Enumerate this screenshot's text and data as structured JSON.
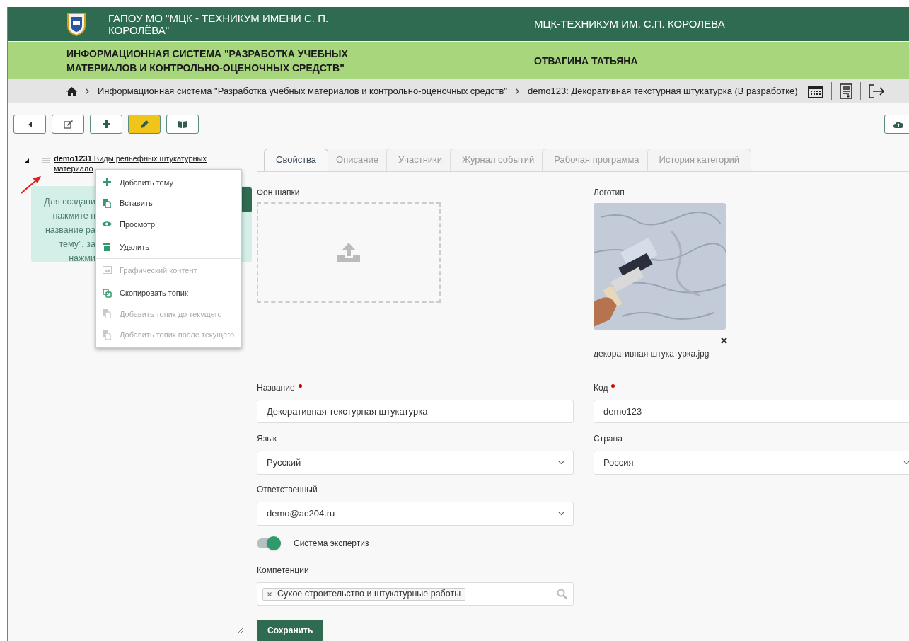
{
  "header": {
    "org_name": "ГАПОУ МО \"МЦК - ТЕХНИКУМ ИМЕНИ С. П. КОРОЛЁВА\"",
    "org_short": "МЦК-ТЕХНИКУМ ИМ. С.П. КОРОЛЕВА",
    "system_title": "ИНФОРМАЦИОННАЯ СИСТЕМА \"РАЗРАБОТКА УЧЕБНЫХ МАТЕРИАЛОВ И КОНТРОЛЬНО-ОЦЕНОЧНЫХ СРЕДСТВ\"",
    "user_name": "ОТВАГИНА ТАТЬЯНА"
  },
  "breadcrumbs": [
    "Информационная система \"Разработка учебных материалов и контрольно-оценочных средств\"",
    "demo123: Декоративная текстурная штукатурка (В разработке)"
  ],
  "toolbar": [
    {
      "active": false
    },
    {
      "active": false
    },
    {
      "active": false
    },
    {
      "active": true
    },
    {
      "active": false
    }
  ],
  "tree": {
    "expanded": true,
    "label": "**demo1231** Виды рельефных штукатурных материало"
  },
  "hint_lines": [
    "Для создани",
    "нажмите п",
    "название ра",
    "тему\", за",
    "нажми"
  ],
  "context_menu": [
    [
      {
        "label": "Добавить тему",
        "disabled": false
      },
      {
        "label": "Вставить",
        "disabled": false
      },
      {
        "label": "Просмотр",
        "disabled": false
      }
    ],
    [
      {
        "label": "Удалить",
        "disabled": false
      }
    ],
    [
      {
        "label": "Графический контент",
        "disabled": true
      }
    ],
    [
      {
        "label": "Скопировать топик",
        "disabled": false
      },
      {
        "label": "Добавить топик до текущего",
        "disabled": true
      },
      {
        "label": "Добавить топик после текущего",
        "disabled": true
      }
    ]
  ],
  "tabs": [
    {
      "label": "Свойства",
      "selected": true
    },
    {
      "label": "Описание",
      "selected": false
    },
    {
      "label": "Участники",
      "selected": false
    },
    {
      "label": "Журнал событий",
      "selected": false
    },
    {
      "label": "Рабочая программа",
      "selected": false
    },
    {
      "label": "История категорий",
      "selected": false
    }
  ],
  "header_background": {
    "label": "Фон шапки"
  },
  "logo": {
    "label": "Логотип",
    "file_name": "декоративная штукатурка.jpg"
  },
  "rows": [
    [
      {
        "kind": "text",
        "label": "Название",
        "required": true,
        "value": "Декоративная текстурная штукатурка"
      },
      {
        "kind": "text",
        "label": "Код",
        "required": true,
        "value": "demo123"
      }
    ],
    [
      {
        "kind": "select",
        "label": "Язык",
        "value": "Русский"
      },
      {
        "kind": "select",
        "label": "Страна",
        "value": "Россия"
      }
    ],
    [
      {
        "kind": "select",
        "label": "Ответственный",
        "value": "demo@ac204.ru"
      }
    ],
    [
      {
        "kind": "toggle",
        "label": "Система экспертиз",
        "on": true
      }
    ],
    [
      {
        "kind": "tags",
        "label": "Компетенции",
        "tags": [
          "Сухое строительство и штукатурные работы"
        ]
      }
    ]
  ],
  "save_label": "Сохранить"
}
